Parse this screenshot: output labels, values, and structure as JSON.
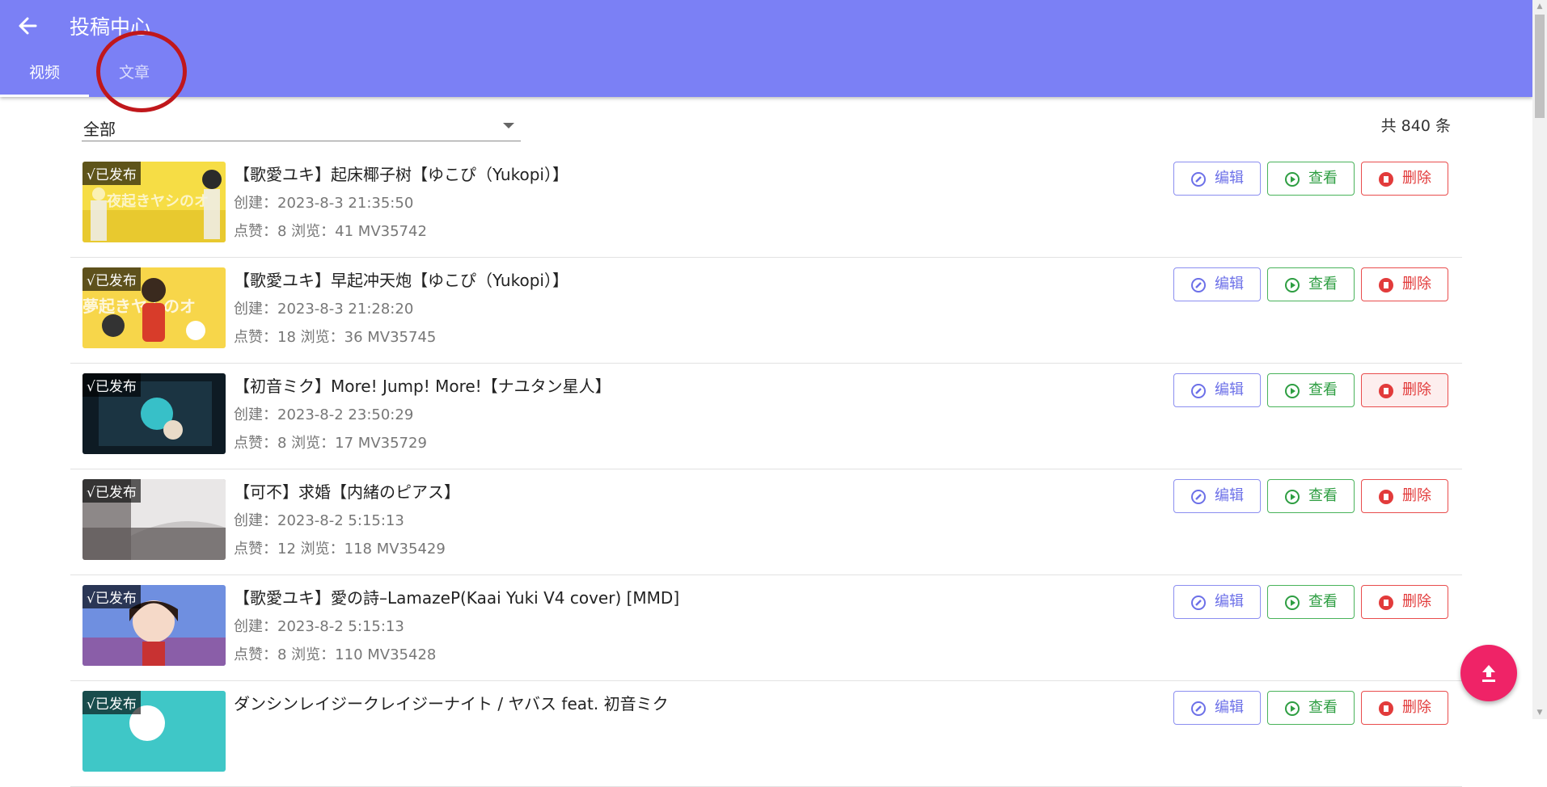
{
  "appbar": {
    "title": "投稿中心"
  },
  "tabs": [
    {
      "label": "视频"
    },
    {
      "label": "文章"
    }
  ],
  "filter": {
    "value": "全部"
  },
  "total": "共 840 条",
  "buttons": {
    "edit": "编辑",
    "view": "查看",
    "delete": "删除"
  },
  "items": [
    {
      "status": "√已发布",
      "title": "【歌愛ユキ】起床椰子树【ゆこぴ（Yukopi）】",
      "created": "创建：2023-8-3 21:35:50",
      "stats": "点赞：8   浏览：41   MV35742",
      "thumb_colors": [
        "#f6dd45",
        "#e8c92f"
      ]
    },
    {
      "status": "√已发布",
      "title": "【歌愛ユキ】早起冲天炮【ゆこぴ（Yukopi）】",
      "created": "创建：2023-8-3 21:28:20",
      "stats": "点赞：18   浏览：36   MV35745",
      "thumb_colors": [
        "#f7d64a",
        "#d9b327"
      ]
    },
    {
      "status": "√已发布",
      "title": "【初音ミク】More! Jump! More!【ナユタン星人】",
      "created": "创建：2023-8-2 23:50:29",
      "stats": "点赞：8   浏览：17   MV35729",
      "thumb_colors": [
        "#1f3b4a",
        "#0e1b24"
      ]
    },
    {
      "status": "√已发布",
      "title": "【可不】求婚【内緒のピアス】",
      "created": "创建：2023-8-2 5:15:13",
      "stats": "点赞：12   浏览：118   MV35429",
      "thumb_colors": [
        "#c9c6c6",
        "#5b5656"
      ]
    },
    {
      "status": "√已发布",
      "title": "【歌愛ユキ】愛の詩–LamazeP(Kaai Yuki V4 cover) [MMD]",
      "created": "创建：2023-8-2 5:15:13",
      "stats": "点赞：8   浏览：110   MV35428",
      "thumb_colors": [
        "#6f8fe0",
        "#8a5ea8"
      ]
    },
    {
      "status": "√已发布",
      "title": "ダンシンレイジークレイジーナイト / ヤバス feat. 初音ミク",
      "created": "",
      "stats": "",
      "thumb_colors": [
        "#3fc7c7",
        "#2aa9b0"
      ]
    }
  ],
  "colors": {
    "appbar": "#7b80f5",
    "accent_fab": "#ef2367",
    "edit": "#6c70e8",
    "view": "#2e9e42",
    "delete": "#e23b3b"
  }
}
